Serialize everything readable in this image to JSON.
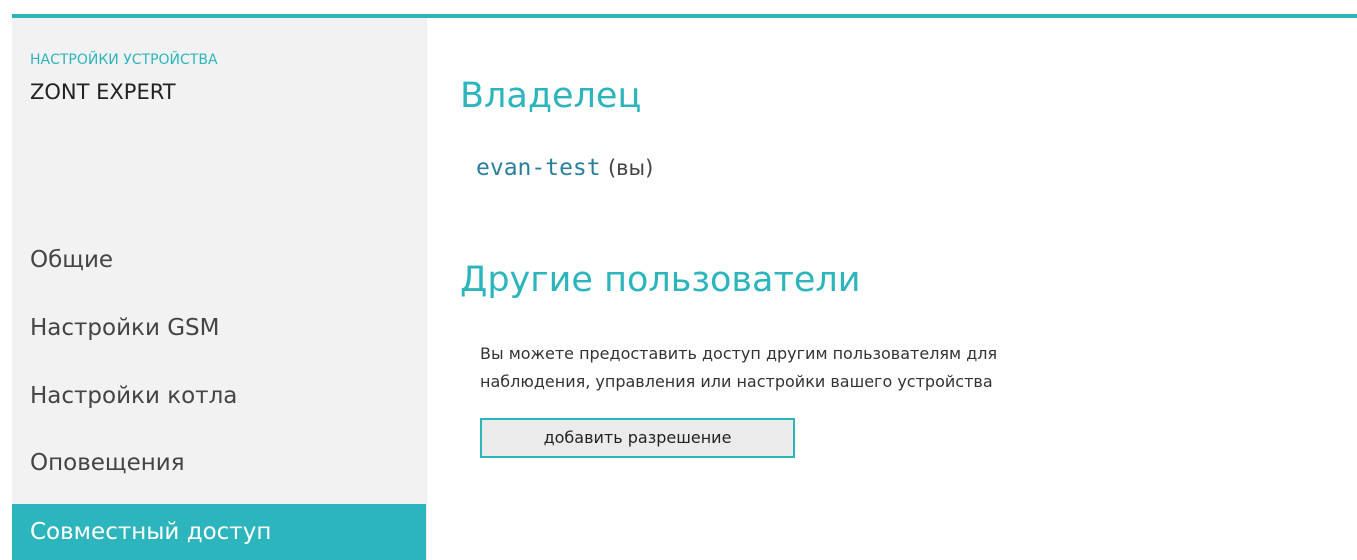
{
  "sidebar": {
    "subtitle": "НАСТРОЙКИ УСТРОЙСТВА",
    "device_name": "ZONT EXPERT",
    "items": [
      {
        "label": "Общие",
        "active": false
      },
      {
        "label": "Настройки GSM",
        "active": false
      },
      {
        "label": "Настройки котла",
        "active": false
      },
      {
        "label": "Оповещения",
        "active": false
      },
      {
        "label": "Совместный доступ",
        "active": true
      }
    ]
  },
  "main": {
    "owner_heading": "Владелец",
    "owner_name": "evan-test",
    "owner_suffix": "(вы)",
    "others_heading": "Другие пользователи",
    "others_description_line1": "Вы можете предоставить доступ другим пользователям для",
    "others_description_line2": "наблюдения, управления или настройки вашего устройства",
    "add_button_label": "добавить разрешение"
  },
  "colors": {
    "accent": "#2cb5bc",
    "sidebar_bg": "#f2f2f2",
    "owner_name": "#2b7f9e"
  }
}
